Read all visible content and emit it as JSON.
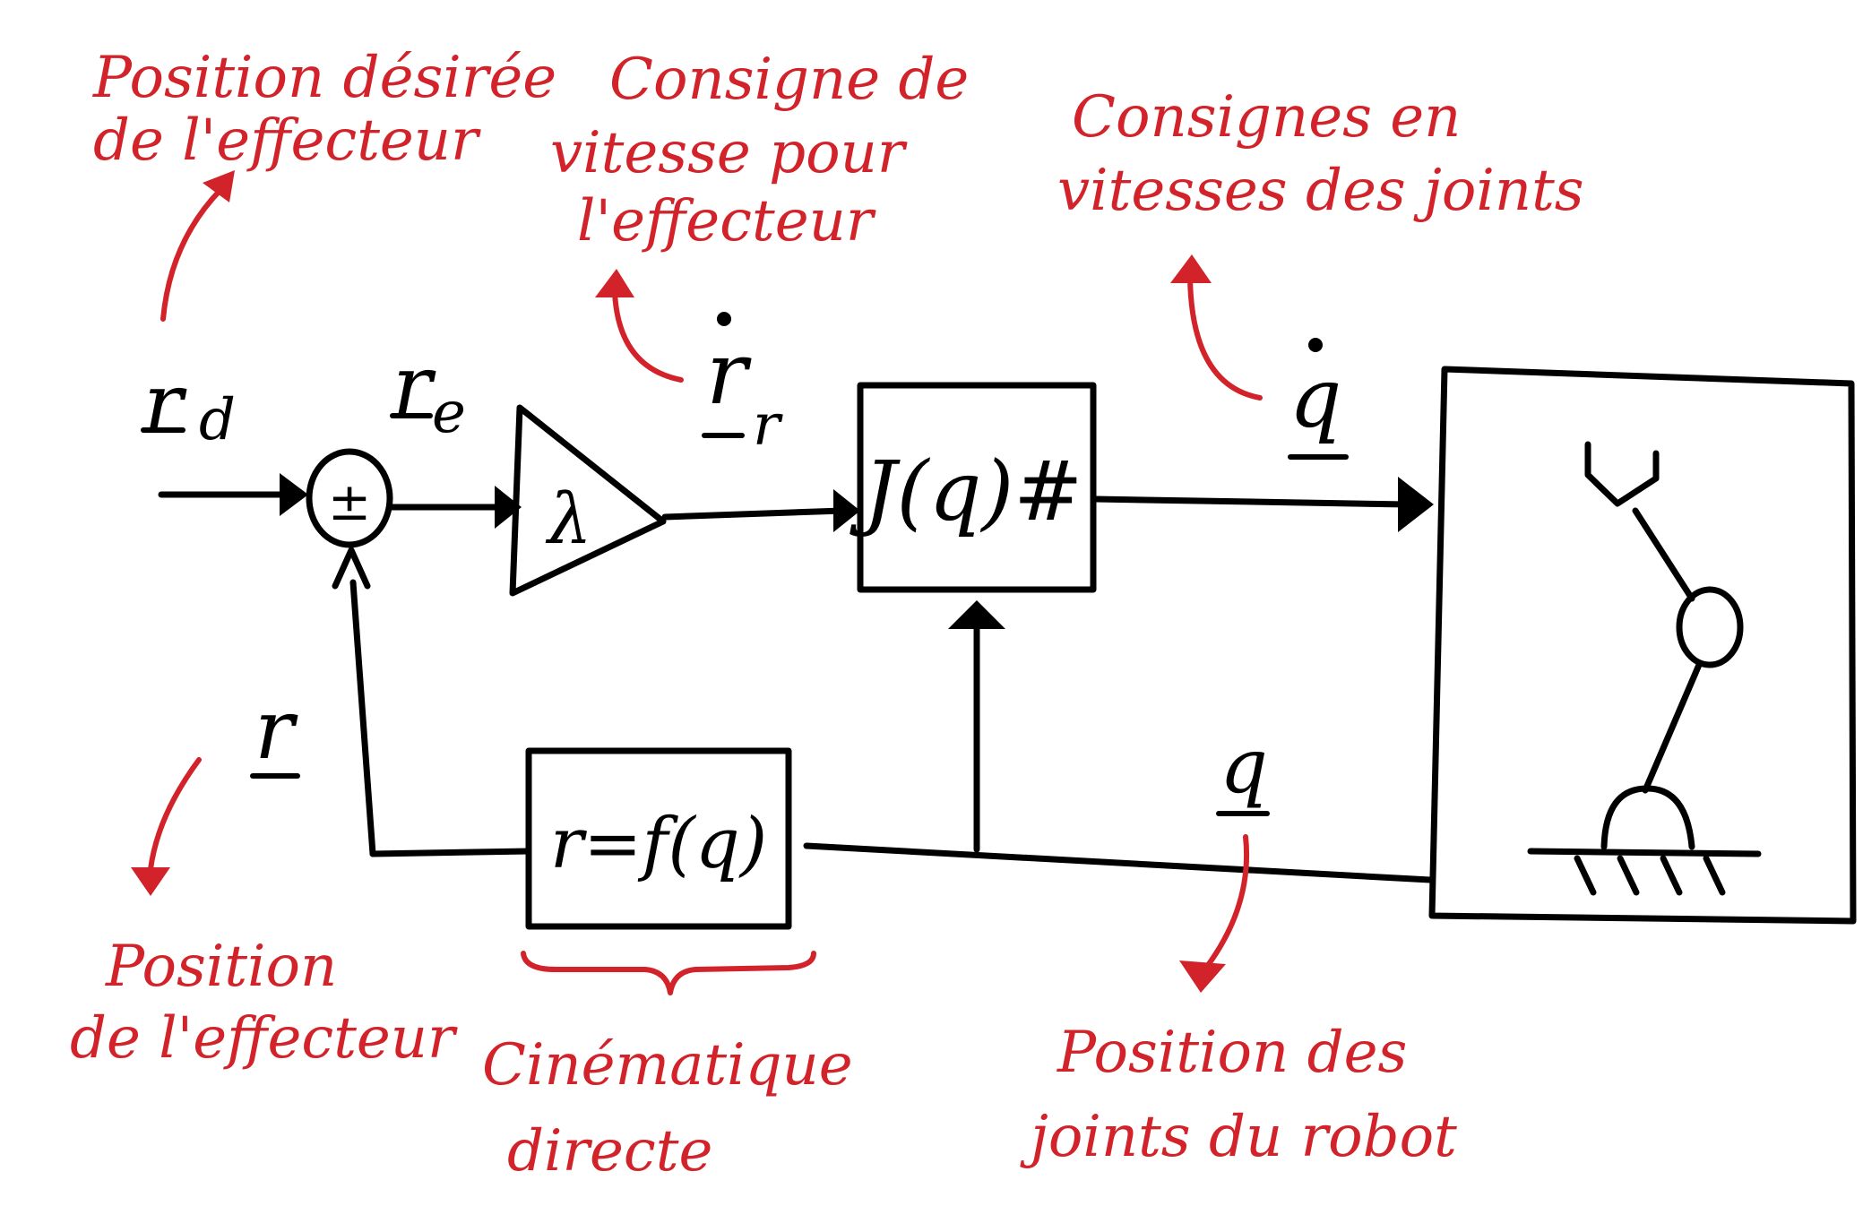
{
  "annotations": {
    "desired_position": [
      "Position désirée",
      "de l'effecteur"
    ],
    "velocity_setpoint": [
      "Consigne de",
      "vitesse pour",
      "l'effecteur"
    ],
    "joint_velocity_setpoints": [
      "Consignes en",
      "vitesses des joints"
    ],
    "effector_position": [
      "Position",
      "de l'effecteur"
    ],
    "forward_kinematics": [
      "Cinématique",
      "directe"
    ],
    "joint_positions": [
      "Position des",
      "joints du robot"
    ]
  },
  "symbols": {
    "r_d_base": "r",
    "r_d_sub": "d",
    "r_e_base": "r",
    "r_e_sub": "e",
    "r_r_base": "r",
    "r_r_sub": "r",
    "q_dot": "q",
    "q": "q",
    "r": "r",
    "summing_sign": "±",
    "gain": "λ"
  },
  "blocks": {
    "jacobian": "J(q)#",
    "kinematics": "r=f(q)"
  },
  "colors": {
    "ink": "#000000",
    "annotation": "#d2232a"
  }
}
